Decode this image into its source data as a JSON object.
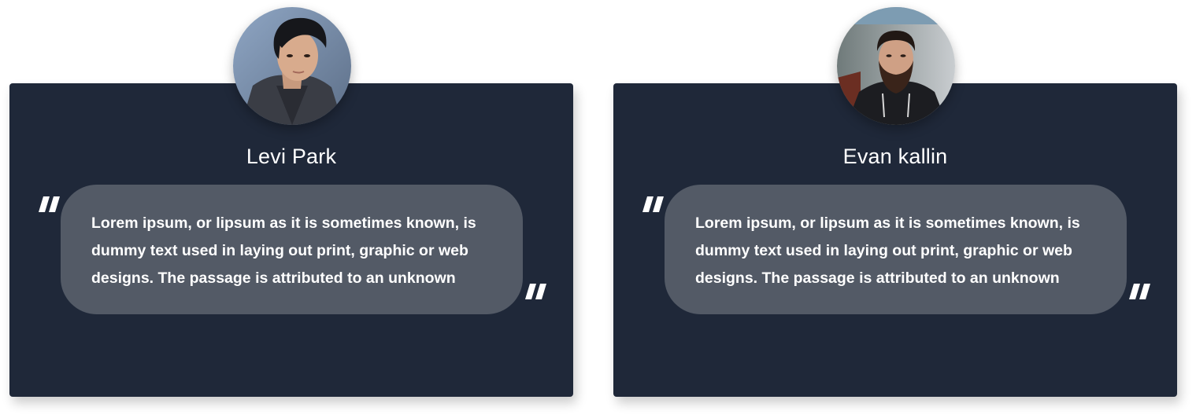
{
  "testimonials": [
    {
      "name": "Levi Park",
      "quote": "Lorem ipsum, or lipsum as it is sometimes known, is dummy text used in laying out print, graphic or web designs. The passage is attributed to an unknown",
      "avatar_icon": "person-photo-avatar"
    },
    {
      "name": "Evan kallin",
      "quote": "Lorem ipsum, or lipsum as it is sometimes known, is dummy text used in laying out print, graphic or web designs. The passage is attributed to an unknown",
      "avatar_icon": "person-photo-avatar"
    }
  ],
  "colors": {
    "card_bg": "#1f2839",
    "bubble_bg": "#535a66",
    "text": "#ffffff",
    "page_bg": "#ffffff"
  },
  "icons": {
    "open_quote": "open-quote-icon",
    "close_quote": "close-quote-icon"
  }
}
